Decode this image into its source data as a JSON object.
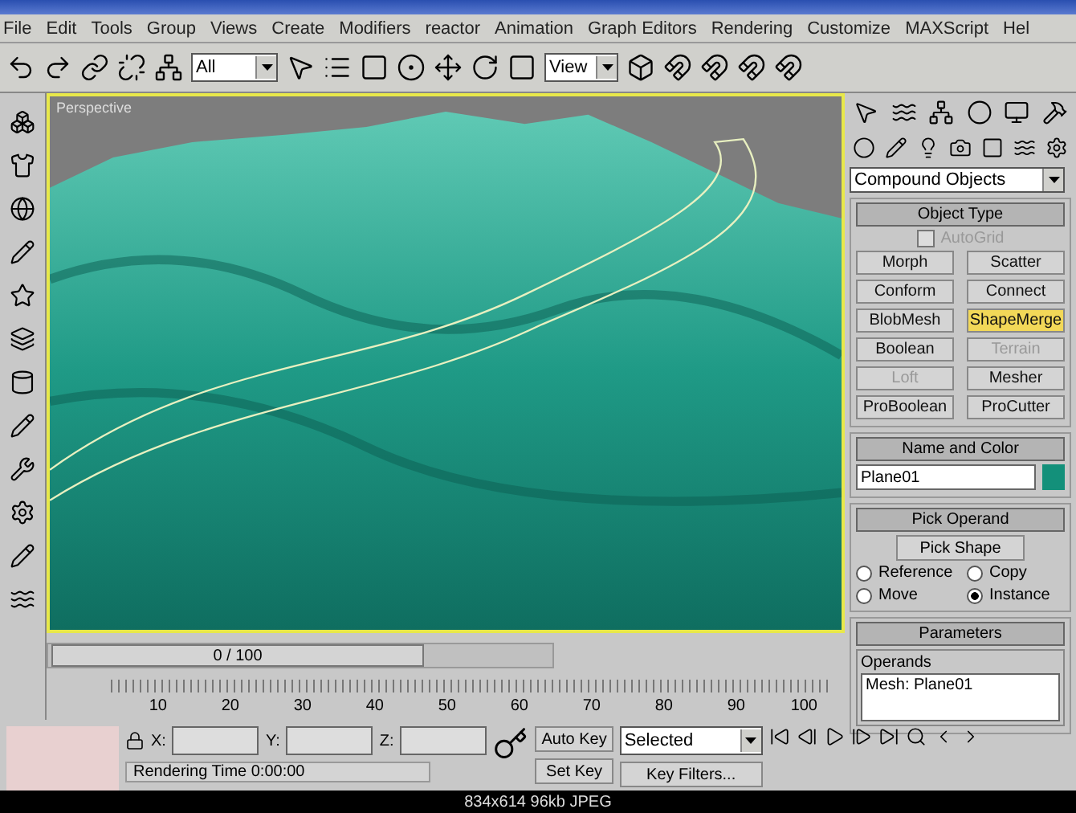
{
  "menu": [
    {
      "label": "File"
    },
    {
      "label": "Edit"
    },
    {
      "label": "Tools"
    },
    {
      "label": "Group"
    },
    {
      "label": "Views"
    },
    {
      "label": "Create"
    },
    {
      "label": "Modifiers"
    },
    {
      "label": "reactor"
    },
    {
      "label": "Animation"
    },
    {
      "label": "Graph Editors"
    },
    {
      "label": "Rendering"
    },
    {
      "label": "Customize"
    },
    {
      "label": "MAXScript"
    },
    {
      "label": "Hel"
    }
  ],
  "toolbar": {
    "selection_filter": "All",
    "reference_coord": "View"
  },
  "viewport": {
    "label": "Perspective"
  },
  "command_panel": {
    "category": "Compound Objects",
    "object_type": {
      "title": "Object Type",
      "autogrid": {
        "label": "AutoGrid",
        "checked": false,
        "disabled": true
      },
      "buttons": [
        {
          "label": "Morph",
          "selected": false,
          "disabled": false
        },
        {
          "label": "Scatter",
          "selected": false,
          "disabled": false
        },
        {
          "label": "Conform",
          "selected": false,
          "disabled": false
        },
        {
          "label": "Connect",
          "selected": false,
          "disabled": false
        },
        {
          "label": "BlobMesh",
          "selected": false,
          "disabled": false
        },
        {
          "label": "ShapeMerge",
          "selected": true,
          "disabled": false
        },
        {
          "label": "Boolean",
          "selected": false,
          "disabled": false
        },
        {
          "label": "Terrain",
          "selected": false,
          "disabled": true
        },
        {
          "label": "Loft",
          "selected": false,
          "disabled": true
        },
        {
          "label": "Mesher",
          "selected": false,
          "disabled": false
        },
        {
          "label": "ProBoolean",
          "selected": false,
          "disabled": false
        },
        {
          "label": "ProCutter",
          "selected": false,
          "disabled": false
        }
      ]
    },
    "name_and_color": {
      "title": "Name and Color",
      "name": "Plane01",
      "color": "#13907a"
    },
    "pick_operand": {
      "title": "Pick Operand",
      "button": "Pick Shape",
      "options": [
        {
          "label": "Reference",
          "selected": false
        },
        {
          "label": "Copy",
          "selected": false
        },
        {
          "label": "Move",
          "selected": false
        },
        {
          "label": "Instance",
          "selected": true
        }
      ]
    },
    "parameters": {
      "title": "Parameters",
      "group": "Operands",
      "items": [
        "Mesh: Plane01"
      ]
    }
  },
  "time_slider": {
    "label": "0 / 100"
  },
  "ruler": [
    "10",
    "20",
    "30",
    "40",
    "50",
    "60",
    "70",
    "80",
    "90",
    "100"
  ],
  "status": {
    "x": "X:",
    "y": "Y:",
    "z": "Z:",
    "auto_key": "Auto Key",
    "set_key": "Set Key",
    "key_mode": "Selected",
    "key_filters": "Key Filters...",
    "rendering_time": "Rendering Time  0:00:00"
  },
  "caption": "834x614  96kb  JPEG"
}
